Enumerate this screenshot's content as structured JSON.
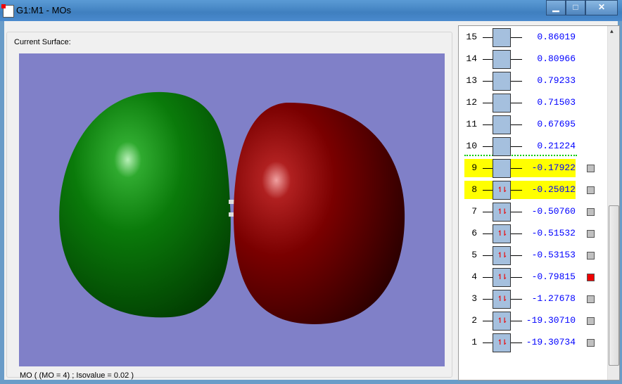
{
  "window": {
    "title": "G1:M1 - MOs",
    "minimize": "▁",
    "maximize": "□",
    "close": "✕"
  },
  "surface": {
    "group_label": "Current Surface:",
    "status": "MO ( (MO = 4) ; Isovalue = 0.02 )"
  },
  "colors": {
    "viewport_bg": "#8080c8",
    "positive_lobe": "#7a0000",
    "negative_lobe": "#0a7a0a",
    "highlight": "#ffff00",
    "energy": "#0000ff"
  },
  "orbitals": [
    {
      "n": "15",
      "energy": "0.86019",
      "occupied": false,
      "highlight": false,
      "checkbox": false
    },
    {
      "n": "14",
      "energy": "0.80966",
      "occupied": false,
      "highlight": false,
      "checkbox": false
    },
    {
      "n": "13",
      "energy": "0.79233",
      "occupied": false,
      "highlight": false,
      "checkbox": false
    },
    {
      "n": "12",
      "energy": "0.71503",
      "occupied": false,
      "highlight": false,
      "checkbox": false
    },
    {
      "n": "11",
      "energy": "0.67695",
      "occupied": false,
      "highlight": false,
      "checkbox": false
    },
    {
      "n": "10",
      "energy": "0.21224",
      "occupied": false,
      "highlight": false,
      "checkbox": false
    },
    {
      "n": "9",
      "energy": "-0.17922",
      "occupied": false,
      "highlight": true,
      "checkbox": "off"
    },
    {
      "n": "8",
      "energy": "-0.25012",
      "occupied": true,
      "highlight": true,
      "checkbox": "off"
    },
    {
      "n": "7",
      "energy": "-0.50760",
      "occupied": true,
      "highlight": false,
      "checkbox": "off"
    },
    {
      "n": "6",
      "energy": "-0.51532",
      "occupied": true,
      "highlight": false,
      "checkbox": "off"
    },
    {
      "n": "5",
      "energy": "-0.53153",
      "occupied": true,
      "highlight": false,
      "checkbox": "off"
    },
    {
      "n": "4",
      "energy": "-0.79815",
      "occupied": true,
      "highlight": false,
      "checkbox": "on"
    },
    {
      "n": "3",
      "energy": "-1.27678",
      "occupied": true,
      "highlight": false,
      "checkbox": "off"
    },
    {
      "n": "2",
      "energy": "-19.30710",
      "occupied": true,
      "highlight": false,
      "checkbox": "off"
    },
    {
      "n": "1",
      "energy": "-19.30734",
      "occupied": true,
      "highlight": false,
      "checkbox": "off"
    }
  ],
  "occupied_symbol": "↿⇂"
}
